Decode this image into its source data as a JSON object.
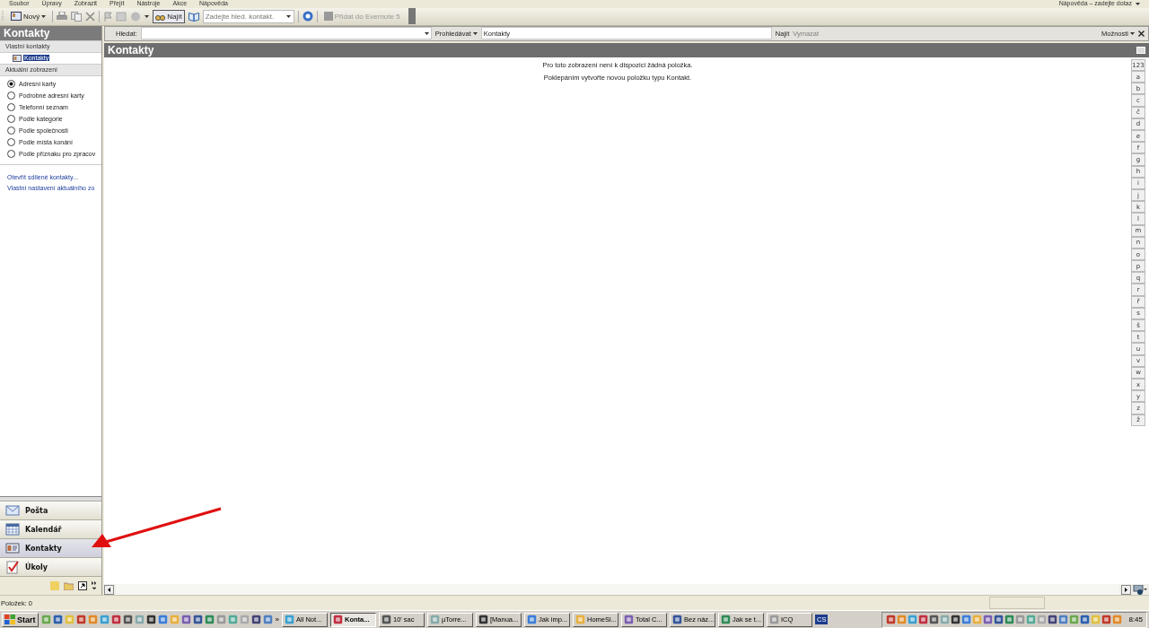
{
  "menu": [
    "Soubor",
    "Úpravy",
    "Zobrazit",
    "Přejít",
    "Nástroje",
    "Akce",
    "Nápověda"
  ],
  "help_box": "Nápověda – zadejte dotaz",
  "toolbar": {
    "new": "Nový",
    "find": "Najít",
    "search_placeholder": "Zadejte hled. kontakt.",
    "evernote": {
      "label": "Přidat do Evernote 5",
      "disabled": true
    }
  },
  "pane": {
    "title": "Kontakty",
    "my_contacts": {
      "title": "Vlastní kontakty",
      "items": [
        {
          "label": "Kontakty",
          "selected": true
        }
      ]
    },
    "current_view": {
      "title": "Aktuální zobrazení",
      "options": [
        {
          "label": "Adresní karty",
          "selected": true
        },
        {
          "label": "Podrobné adresní karty",
          "selected": false
        },
        {
          "label": "Telefonní seznam",
          "selected": false
        },
        {
          "label": "Podle kategorie",
          "selected": false
        },
        {
          "label": "Podle společnosti",
          "selected": false
        },
        {
          "label": "Podle místa konání",
          "selected": false
        },
        {
          "label": "Podle příznaku pro zpracov",
          "selected": false
        }
      ]
    },
    "links": [
      "Otevřít sdílené kontakty...",
      "Vlastní nastavení aktuálního zo"
    ]
  },
  "nav": [
    {
      "label": "Pošta",
      "kind": "mail",
      "selected": false
    },
    {
      "label": "Kalendář",
      "kind": "calendar",
      "selected": false
    },
    {
      "label": "Kontakty",
      "kind": "contacts",
      "selected": true
    },
    {
      "label": "Úkoly",
      "kind": "tasks",
      "selected": false
    }
  ],
  "find_bar": {
    "label": "Hledat:",
    "scope": "Prohledávat",
    "scope_value": "Kontakty",
    "find": "Najít",
    "clear": {
      "label": "Vymazat",
      "disabled": true
    },
    "options": "Možnosti"
  },
  "view": {
    "title": "Kontakty",
    "messages": [
      "Pro toto zobrazení není k dispozici žádná položka.",
      "Poklepáním vytvořte novou položku typu Kontakt."
    ]
  },
  "index_letters": [
    "123",
    "a",
    "b",
    "c",
    "č",
    "d",
    "e",
    "f",
    "g",
    "h",
    "i",
    "j",
    "k",
    "l",
    "m",
    "n",
    "o",
    "p",
    "q",
    "r",
    "ř",
    "s",
    "š",
    "t",
    "u",
    "v",
    "w",
    "x",
    "y",
    "z",
    "ž"
  ],
  "status": "Položek: 0",
  "taskbar": {
    "start": "Start",
    "more": "»",
    "tasks": [
      {
        "label": "All Not...",
        "selected": false
      },
      {
        "label": "Konta...",
        "selected": true
      },
      {
        "label": "10' sac",
        "selected": false
      },
      {
        "label": "µTorre...",
        "selected": false
      },
      {
        "label": "[Manua...",
        "selected": false
      },
      {
        "label": "Jak imp...",
        "selected": false
      },
      {
        "label": "HomeSi...",
        "selected": false
      },
      {
        "label": "Total C...",
        "selected": false
      },
      {
        "label": "Bez náz...",
        "selected": false
      },
      {
        "label": "Jak se t...",
        "selected": false
      },
      {
        "label": "ICQ",
        "selected": false
      }
    ],
    "language": "CS",
    "clock": "8:45"
  }
}
